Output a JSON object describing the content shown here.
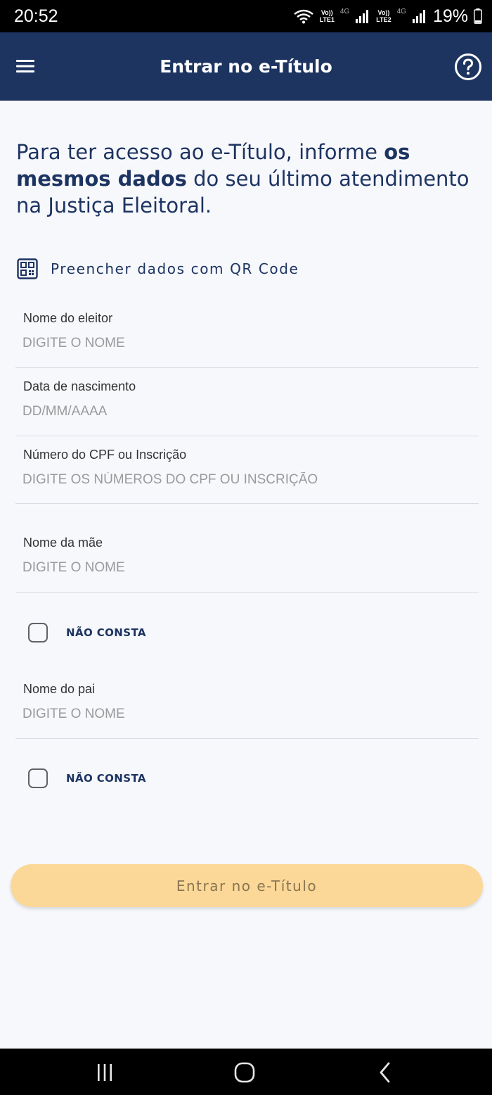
{
  "status_bar": {
    "time": "20:52",
    "sim1_top": "Vo))",
    "sim1_bottom": "LTE1",
    "sim2_top": "Vo))",
    "sim2_bottom": "LTE2",
    "network": "4G",
    "battery": "19%"
  },
  "app_bar": {
    "title": "Entrar no e-Título",
    "menu_icon": "hamburger-icon",
    "help_icon": "help-circle-icon"
  },
  "intro": {
    "part1": "Para ter acesso ao e-Título, informe ",
    "bold": "os mesmos dados",
    "part2": " do seu último atendimento na Justiça Eleitoral."
  },
  "qr": {
    "label": "Preencher dados com QR Code",
    "icon": "qr-code-icon"
  },
  "fields": {
    "nome": {
      "label": "Nome do eleitor",
      "placeholder": "DIGITE O NOME",
      "value": ""
    },
    "data": {
      "label": "Data de nascimento",
      "placeholder": "DD/MM/AAAA",
      "value": ""
    },
    "cpf": {
      "label": "Número do CPF ou Inscrição",
      "placeholder": "DIGITE OS NÚMEROS DO CPF OU INSCRIÇÃO",
      "value": ""
    },
    "mae": {
      "label": "Nome da mãe",
      "placeholder": "DIGITE O NOME",
      "value": ""
    },
    "pai": {
      "label": "Nome do pai",
      "placeholder": "DIGITE O NOME",
      "value": ""
    }
  },
  "checkboxes": {
    "mae_nao_consta": {
      "label": "NÃO CONSTA",
      "checked": false
    },
    "pai_nao_consta": {
      "label": "NÃO CONSTA",
      "checked": false
    }
  },
  "submit": {
    "label": "Entrar no e-Título",
    "enabled": false
  },
  "colors": {
    "primary": "#1d3461",
    "button_disabled": "#fbd898",
    "background": "#f7f8fc"
  }
}
